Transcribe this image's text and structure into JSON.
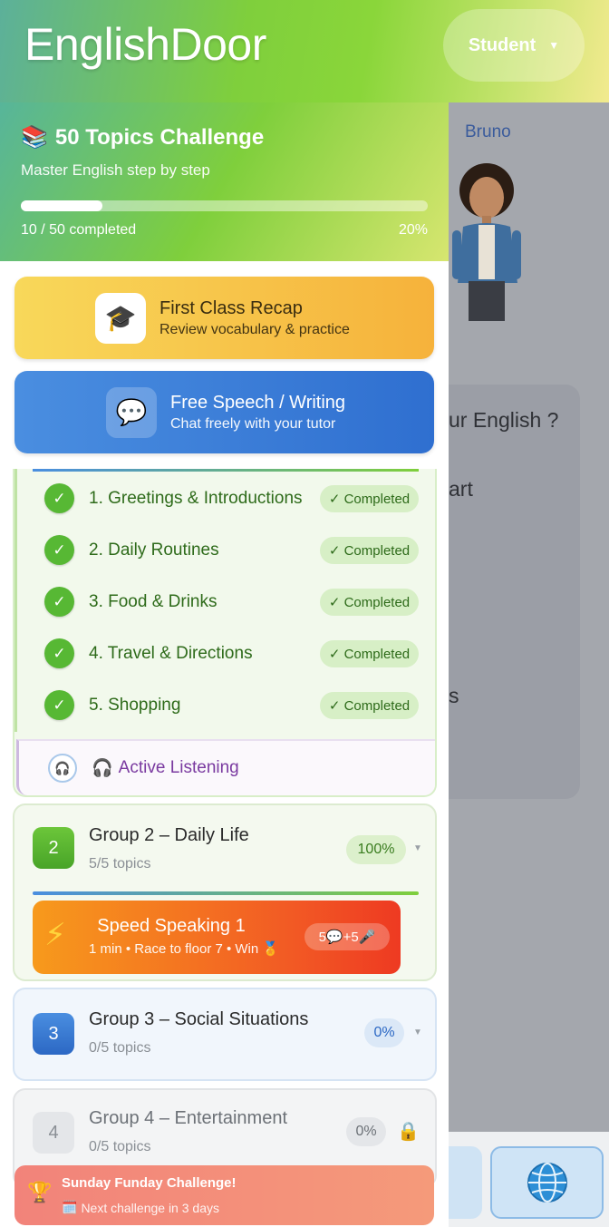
{
  "header": {
    "brand": "EnglishDoor",
    "role_label": "Student"
  },
  "challenge": {
    "title": "50 Topics Challenge",
    "subtitle": "Master English step by step",
    "completed_text": "10 / 50 completed",
    "percent_text": "20%",
    "progress_fraction": 0.2
  },
  "cards": {
    "recap": {
      "title": "First Class Recap",
      "subtitle": "Review vocabulary & practice"
    },
    "speech": {
      "title": "Free Speech / Writing",
      "subtitle": "Chat freely with your tutor"
    }
  },
  "group1": {
    "topics": [
      {
        "label": "1. Greetings & Introductions",
        "status": "✓ Completed"
      },
      {
        "label": "2. Daily Routines",
        "status": "✓ Completed"
      },
      {
        "label": "3. Food & Drinks",
        "status": "✓ Completed"
      },
      {
        "label": "4. Travel & Directions",
        "status": "✓ Completed"
      },
      {
        "label": "5. Shopping",
        "status": "✓ Completed"
      }
    ],
    "listening_label": "Active Listening"
  },
  "groups": [
    {
      "number": "2",
      "title": "Group 2 – Daily Life",
      "subtitle": "5/5 topics",
      "percent": "100%"
    },
    {
      "number": "3",
      "title": "Group 3 – Social Situations",
      "subtitle": "0/5 topics",
      "percent": "0%"
    },
    {
      "number": "4",
      "title": "Group 4 – Entertainment",
      "subtitle": "0/5 topics",
      "percent": "0%"
    }
  ],
  "speed_speaking": {
    "title": "Speed Speaking 1",
    "subtitle": "1 min • Race to floor 7 • Win",
    "reward": "5💬+5🎤"
  },
  "sunday": {
    "title": "Sunday Funday Challenge!",
    "subtitle": "Next challenge in 3 days"
  },
  "tutor": {
    "name": "Bruno",
    "chat_fragments": [
      "ur English ?",
      "art",
      "s"
    ]
  },
  "colors": {
    "accent_green": "#7fcf3c",
    "accent_blue": "#2f6fd0",
    "accent_orange": "#f6b23b"
  }
}
